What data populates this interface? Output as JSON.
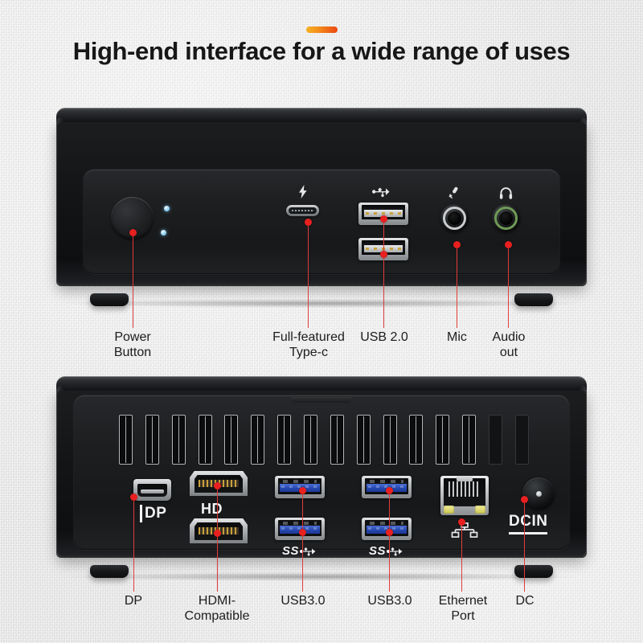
{
  "header": {
    "title": "High-end interface for a wide range of uses",
    "accent_color_start": "#f5b423",
    "accent_color_end": "#e8470f"
  },
  "colors": {
    "background": "#e8e8e8",
    "chassis": "#15161a",
    "leader_line": "#e23b3b",
    "usb3_blue": "#2647b0",
    "audio_green": "#6f9a56",
    "led_blue": "#63b9e8",
    "ethernet_led": "#ccc651"
  },
  "front_device": {
    "name": "front-panel",
    "ports": [
      {
        "id": "power-button",
        "icon": "power-button-icon",
        "label": "Power\nButton"
      },
      {
        "id": "type-c",
        "icon": "thunderbolt-icon",
        "label": "Full-featured\nType-c"
      },
      {
        "id": "usb2",
        "icon": "usb-trident-icon",
        "label": "USB 2.0"
      },
      {
        "id": "mic",
        "icon": "microphone-icon",
        "label": "Mic"
      },
      {
        "id": "audio-out",
        "icon": "headphone-icon",
        "label": "Audio\nout"
      }
    ],
    "indicator_count": 2
  },
  "rear_device": {
    "name": "rear-panel",
    "vent_count": 14,
    "vent_dim_count": 2,
    "port_marks": {
      "dp_logo": "DP",
      "hdmi_logo": "HD",
      "usb3_logo_left": "SS",
      "usb3_logo_right": "SS",
      "dc_logo": "DCIN"
    },
    "ports": [
      {
        "id": "dp",
        "icon": "displayport-icon",
        "label": "DP"
      },
      {
        "id": "hdmi",
        "icon": "hdmi-icon",
        "label": "HDMI-\nCompatible"
      },
      {
        "id": "usb3-a",
        "icon": "usb-ss-icon",
        "label": "USB3.0"
      },
      {
        "id": "usb3-b",
        "icon": "usb-ss-icon",
        "label": "USB3.0"
      },
      {
        "id": "ethernet",
        "icon": "rj45-icon",
        "label": "Ethernet\nPort"
      },
      {
        "id": "dc",
        "icon": "dc-jack-icon",
        "label": "DC"
      }
    ]
  }
}
